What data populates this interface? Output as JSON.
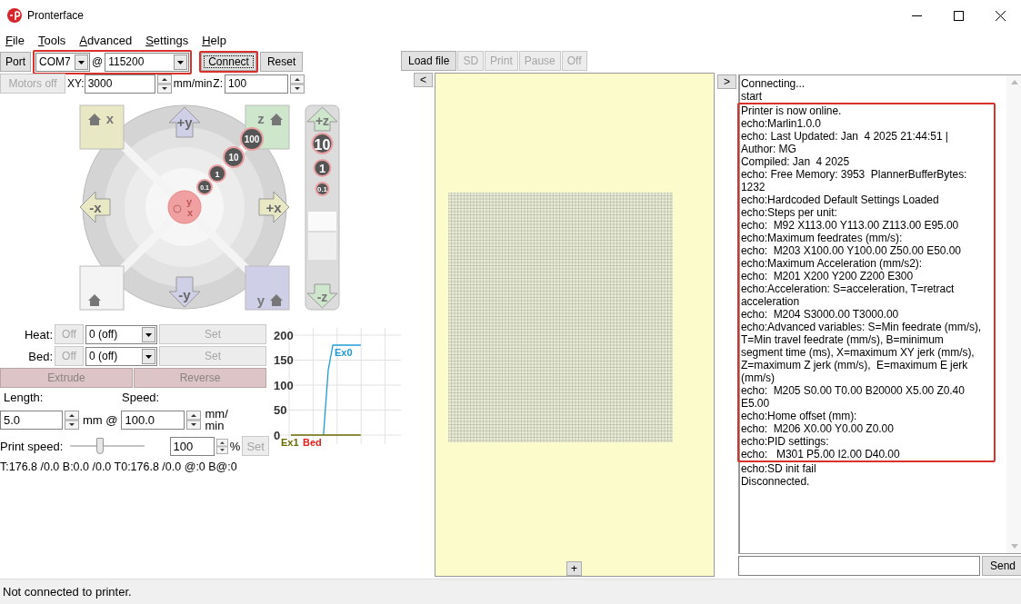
{
  "window": {
    "title": "Pronterface"
  },
  "menu": [
    "File",
    "Tools",
    "Advanced",
    "Settings",
    "Help"
  ],
  "connection": {
    "port_button": "Port",
    "port": "COM7",
    "at": "@",
    "baud": "115200",
    "highlighted": true
  },
  "connect_button": {
    "label": "Connect",
    "highlighted": true
  },
  "reset_button": {
    "label": "Reset"
  },
  "file_buttons": [
    {
      "label": "Load file",
      "disabled": false
    },
    {
      "label": "SD",
      "disabled": true
    },
    {
      "label": "Print",
      "disabled": true
    },
    {
      "label": "Pause",
      "disabled": true
    },
    {
      "label": "Off",
      "disabled": true
    }
  ],
  "motion": {
    "motors_off": {
      "label": "Motors off",
      "disabled": true
    },
    "xy_label": "XY:",
    "xy_feed": "3000",
    "xy_unit": "mm/min",
    "z_label": "Z:",
    "z_feed": "100"
  },
  "jog": {
    "home_labels": [
      "x",
      "z",
      "y"
    ],
    "xy_arrows": [
      "+y",
      "-x",
      "+x",
      "-y"
    ],
    "xy_steps": [
      "0.1",
      "1",
      "10",
      "100"
    ],
    "center_labels": [
      "y",
      "x"
    ],
    "z_arrows": [
      "+z",
      "-z"
    ],
    "z_steps": [
      "10",
      "1",
      "0.1"
    ]
  },
  "temperatures": [
    {
      "label": "Heat:",
      "off_button": "Off",
      "value": "0 (off)",
      "set_button": "Set",
      "disabled": true
    },
    {
      "label": "Bed:",
      "off_button": "Off",
      "value": "0 (off)",
      "set_button": "Set",
      "disabled": true
    }
  ],
  "extrude_buttons": [
    {
      "label": "Extrude",
      "disabled": true
    },
    {
      "label": "Reverse",
      "disabled": true
    }
  ],
  "extrusion": {
    "length_label": "Length:",
    "length": "5.0",
    "length_unit": "mm @",
    "speed_label": "Speed:",
    "speed": "100.0",
    "speed_unit": "mm/ min"
  },
  "print_speed": {
    "label": "Print speed:",
    "level": 0.4,
    "value": "100",
    "unit": "%",
    "set_button": "Set",
    "disabled": true
  },
  "temp_status": "T:176.8 /0.0 B:0.0 /0.0 T0:176.8 /0.0 @:0 B@:0",
  "temp_graph": {
    "chart_data": {
      "type": "line",
      "categories": [
        null,
        null,
        null,
        null,
        null,
        null,
        null,
        null,
        null,
        null,
        null,
        null,
        null,
        null,
        null,
        null,
        null,
        null,
        null,
        null,
        null,
        null,
        null,
        null,
        null,
        null
      ],
      "ylim": [
        0,
        200
      ],
      "grid": true,
      "yticks": [
        0,
        50,
        100,
        150,
        200
      ],
      "series": [
        {
          "name": "Ex0",
          "color": "#1e9ad6",
          "values": [
            null,
            null,
            null,
            null,
            null,
            null,
            null,
            0,
            130,
            180,
            180,
            180,
            180,
            180,
            180,
            180,
            null,
            null,
            null,
            null,
            null,
            null,
            null,
            null,
            null,
            null
          ]
        },
        {
          "name": "Ex1",
          "color": "#6b6b00",
          "values": [
            0,
            0,
            0,
            0,
            0,
            0,
            0,
            0,
            0,
            0,
            0,
            0,
            0,
            0,
            0,
            0,
            null,
            null,
            null,
            null,
            null,
            null,
            null,
            null,
            null,
            null
          ]
        },
        {
          "name": "Bed",
          "color": "#e0201a",
          "values": [
            null,
            null,
            null,
            null,
            null,
            null,
            null,
            null,
            null,
            null,
            null,
            null,
            null,
            null,
            null,
            null,
            null,
            null,
            null,
            null,
            null,
            null,
            null,
            null,
            null,
            null
          ]
        }
      ]
    }
  },
  "plate": {
    "prev_button": "<",
    "add_button": "+"
  },
  "console": {
    "next_button": ">",
    "send_button": "Send",
    "log": [
      {
        "highlighted": false,
        "lines": [
          "Connecting...",
          "start"
        ]
      },
      {
        "highlighted": true,
        "lines": [
          "Printer is now online.",
          "echo:Marlin1.0.0",
          "echo: Last Updated: Jan  4 2025 21:44:51 |",
          "Author: MG",
          "Compiled: Jan  4 2025",
          "echo: Free Memory: 3953  PlannerBufferBytes:",
          "1232",
          "echo:Hardcoded Default Settings Loaded",
          "echo:Steps per unit:",
          "echo:  M92 X113.00 Y113.00 Z113.00 E95.00",
          "echo:Maximum feedrates (mm/s):",
          "echo:  M203 X100.00 Y100.00 Z50.00 E50.00",
          "echo:Maximum Acceleration (mm/s2):",
          "echo:  M201 X200 Y200 Z200 E300",
          "echo:Acceleration: S=acceleration, T=retract",
          "acceleration",
          "echo:  M204 S3000.00 T3000.00",
          "echo:Advanced variables: S=Min feedrate (mm/s),",
          "T=Min travel feedrate (mm/s), B=minimum",
          "segment time (ms), X=maximum XY jerk (mm/s),",
          "Z=maximum Z jerk (mm/s),  E=maximum E jerk",
          "(mm/s)",
          "echo:  M205 S0.00 T0.00 B20000 X5.00 Z0.40",
          "E5.00",
          "echo:Home offset (mm):",
          "echo:  M206 X0.00 Y0.00 Z0.00",
          "echo:PID settings:",
          "echo:   M301 P5.00 I2.00 D40.00"
        ]
      },
      {
        "highlighted": false,
        "lines": [
          "echo:SD init fail",
          "Disconnected."
        ]
      }
    ]
  },
  "status_bar": "Not connected to printer."
}
